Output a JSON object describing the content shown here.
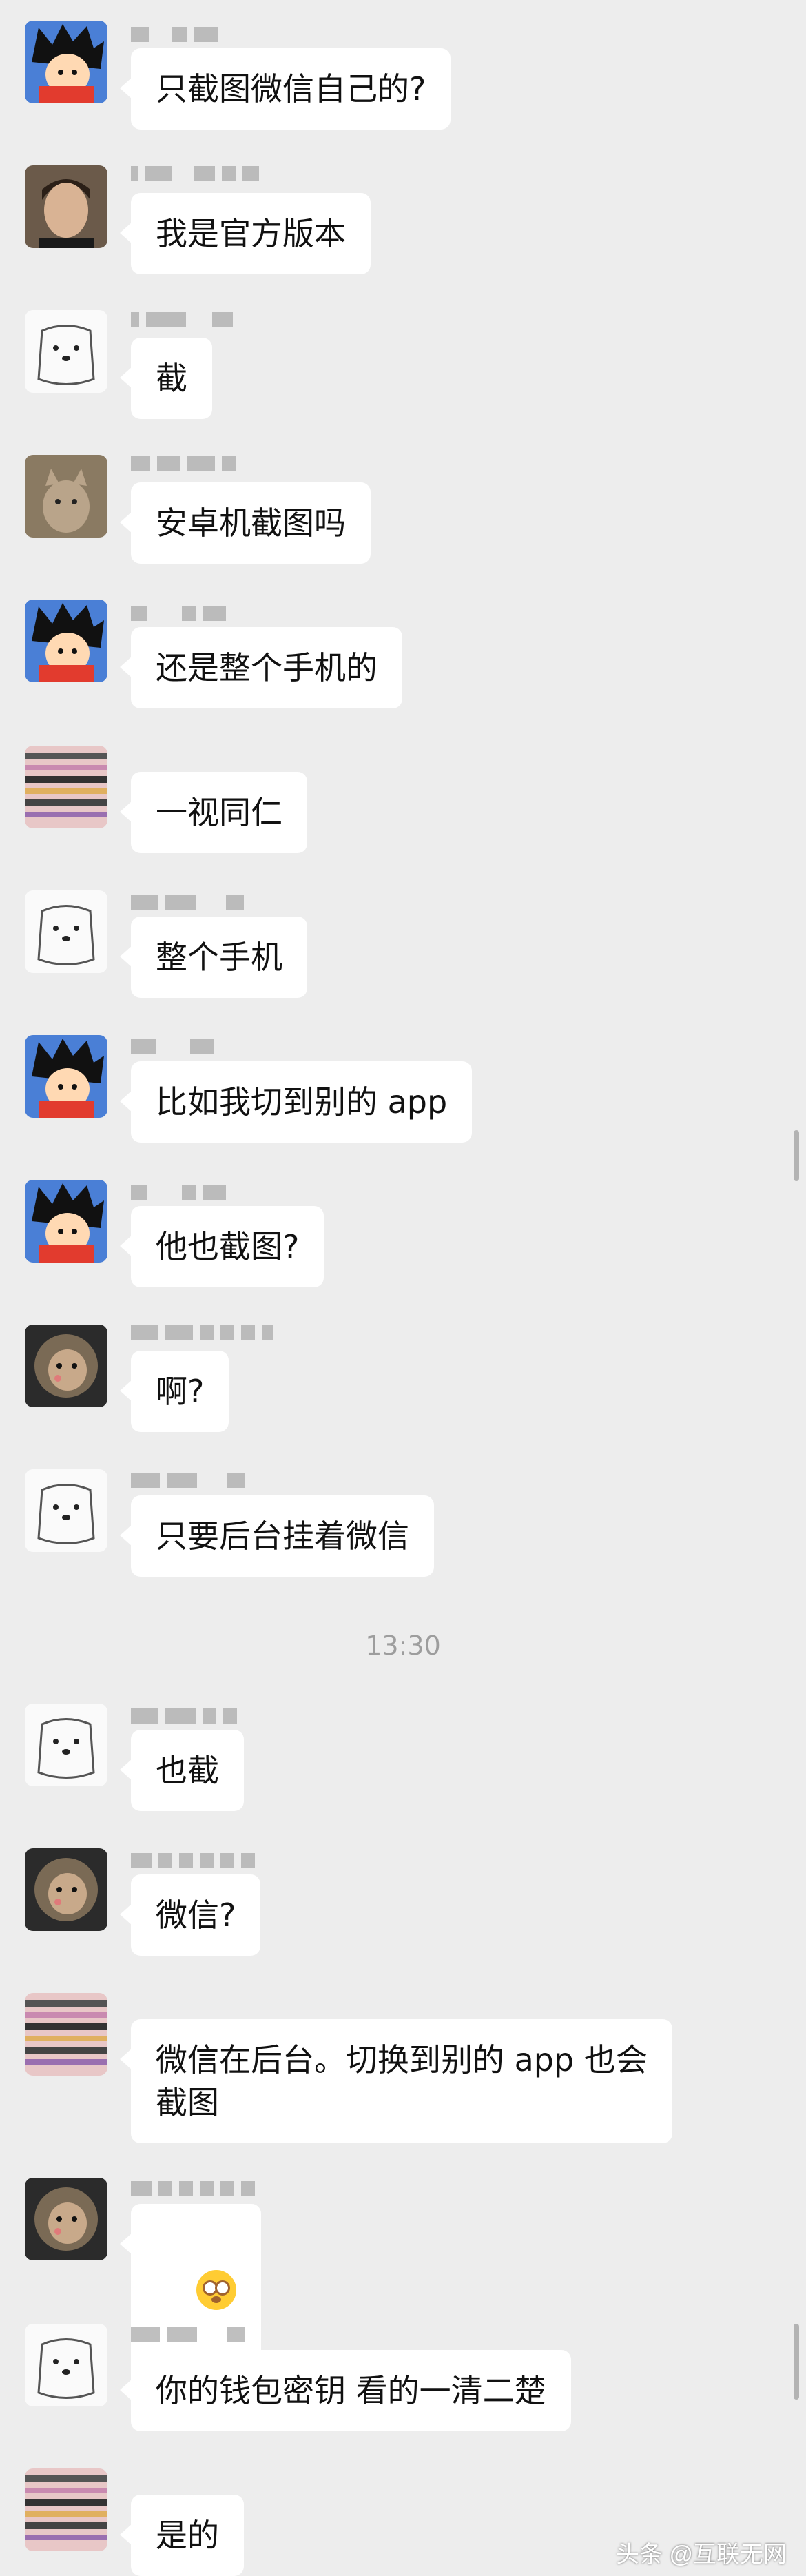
{
  "messages": [
    {
      "avatar": "goku-avatar",
      "text": "只截图微信自己的?"
    },
    {
      "avatar": "man-photo-avatar",
      "text": "我是官方版本"
    },
    {
      "avatar": "sketch-dog-avatar",
      "text": "截"
    },
    {
      "avatar": "cat-photo-avatar",
      "text": "安卓机截图吗"
    },
    {
      "avatar": "goku-avatar",
      "text": "还是整个手机的"
    },
    {
      "avatar": "pixelated-avatar",
      "text": "一视同仁"
    },
    {
      "avatar": "sketch-dog-avatar",
      "text": "整个手机"
    },
    {
      "avatar": "goku-avatar",
      "text": "比如我切到别的 app"
    },
    {
      "avatar": "goku-avatar",
      "text": "他也截图?"
    },
    {
      "avatar": "round-cat-avatar",
      "text": "啊?"
    },
    {
      "avatar": "sketch-dog-avatar",
      "text": "只要后台挂着微信"
    },
    {
      "avatar": "sketch-dog-avatar",
      "text": "也截"
    },
    {
      "avatar": "round-cat-avatar",
      "text": "微信?"
    },
    {
      "avatar": "pixelated-avatar",
      "text": "微信在后台。切换到别的 app 也会\n截图"
    },
    {
      "avatar": "round-cat-avatar",
      "text": "",
      "emoji": "flushed-face-emoji"
    },
    {
      "avatar": "sketch-dog-avatar",
      "text": "你的钱包密钥 看的一清二楚"
    },
    {
      "avatar": "pixelated-avatar",
      "text": "是的"
    }
  ],
  "timestamp": "13:30",
  "watermark": "头条 @互联无网",
  "colors": {
    "background": "#ededed",
    "bubble": "#ffffff",
    "name_blur": "#a9a9a9",
    "timestamp": "#9d9d9d"
  }
}
